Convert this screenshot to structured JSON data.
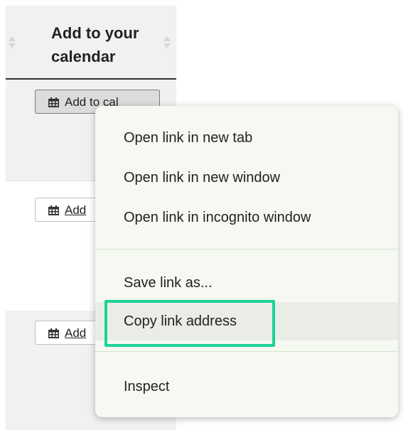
{
  "table": {
    "header": {
      "title": "Add to your\ncalendar"
    },
    "rows": [
      {
        "button_label": "Add to cal"
      },
      {
        "button_label": "Add"
      },
      {
        "button_label": "Add"
      }
    ]
  },
  "context_menu": {
    "items": [
      {
        "label": "Open link in new tab"
      },
      {
        "label": "Open link in new window"
      },
      {
        "label": "Open link in incognito window"
      },
      {
        "label": "Save link as..."
      },
      {
        "label": "Copy link address"
      },
      {
        "label": "Inspect"
      }
    ],
    "highlighted_item": "Copy link address",
    "focus_color": "#1ed198"
  },
  "icons": [
    "calendar-icon",
    "sort-icon"
  ]
}
